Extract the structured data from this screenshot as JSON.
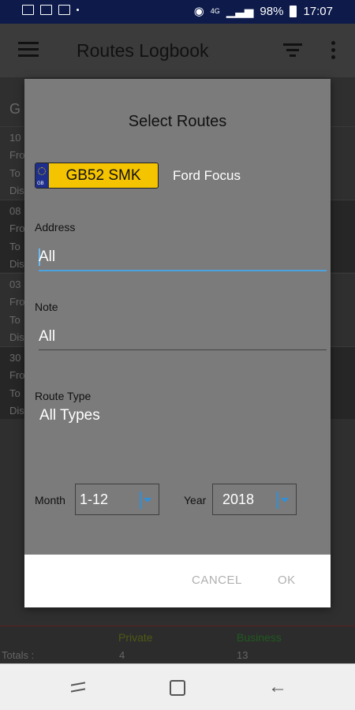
{
  "status_bar": {
    "signal_label": "4G",
    "battery": "98%",
    "time": "17:07",
    "icons": [
      "gallery-icon",
      "folder-icon",
      "calendar-icon",
      "dot-icon",
      "location-icon",
      "signal-icon",
      "battery-icon"
    ]
  },
  "app_bar": {
    "title": "Routes Logbook",
    "icons": [
      "menu-icon",
      "filter-icon",
      "more-vert-icon"
    ]
  },
  "background_list": {
    "header": "G",
    "rows": [
      {
        "date": "10",
        "from": "Fro",
        "to": "To",
        "dist": "Dis"
      },
      {
        "date": "08",
        "from": "Fro",
        "to": "To",
        "dist": "Dis"
      },
      {
        "date": "03",
        "from": "Fro",
        "to": "To",
        "dist": "Dis"
      },
      {
        "date": "30",
        "from": "Fro",
        "to": "To",
        "dist": "Dis"
      }
    ]
  },
  "totals": {
    "private_label": "Private",
    "business_label": "Business",
    "totals_label": "Totals :",
    "private_value": "4",
    "business_value": "13",
    "private_color": "#4d5a14",
    "business_color": "#1f5a1f"
  },
  "dialog": {
    "title": "Select Routes",
    "plate": {
      "region": "GB",
      "number": "GB52 SMK",
      "color": "#f5c400"
    },
    "vehicle": "Ford Focus",
    "address": {
      "label": "Address",
      "value": "All"
    },
    "note": {
      "label": "Note",
      "value": "All"
    },
    "route_type": {
      "label": "Route Type",
      "value": "All Types"
    },
    "month": {
      "label": "Month",
      "value": "1-12"
    },
    "year": {
      "label": "Year",
      "value": "2018"
    },
    "cancel_label": "CANCEL",
    "ok_label": "OK",
    "accent_color": "#4aa3e0"
  },
  "nav_bar": {
    "icons": [
      "recent-apps-icon",
      "home-icon",
      "back-icon"
    ]
  }
}
